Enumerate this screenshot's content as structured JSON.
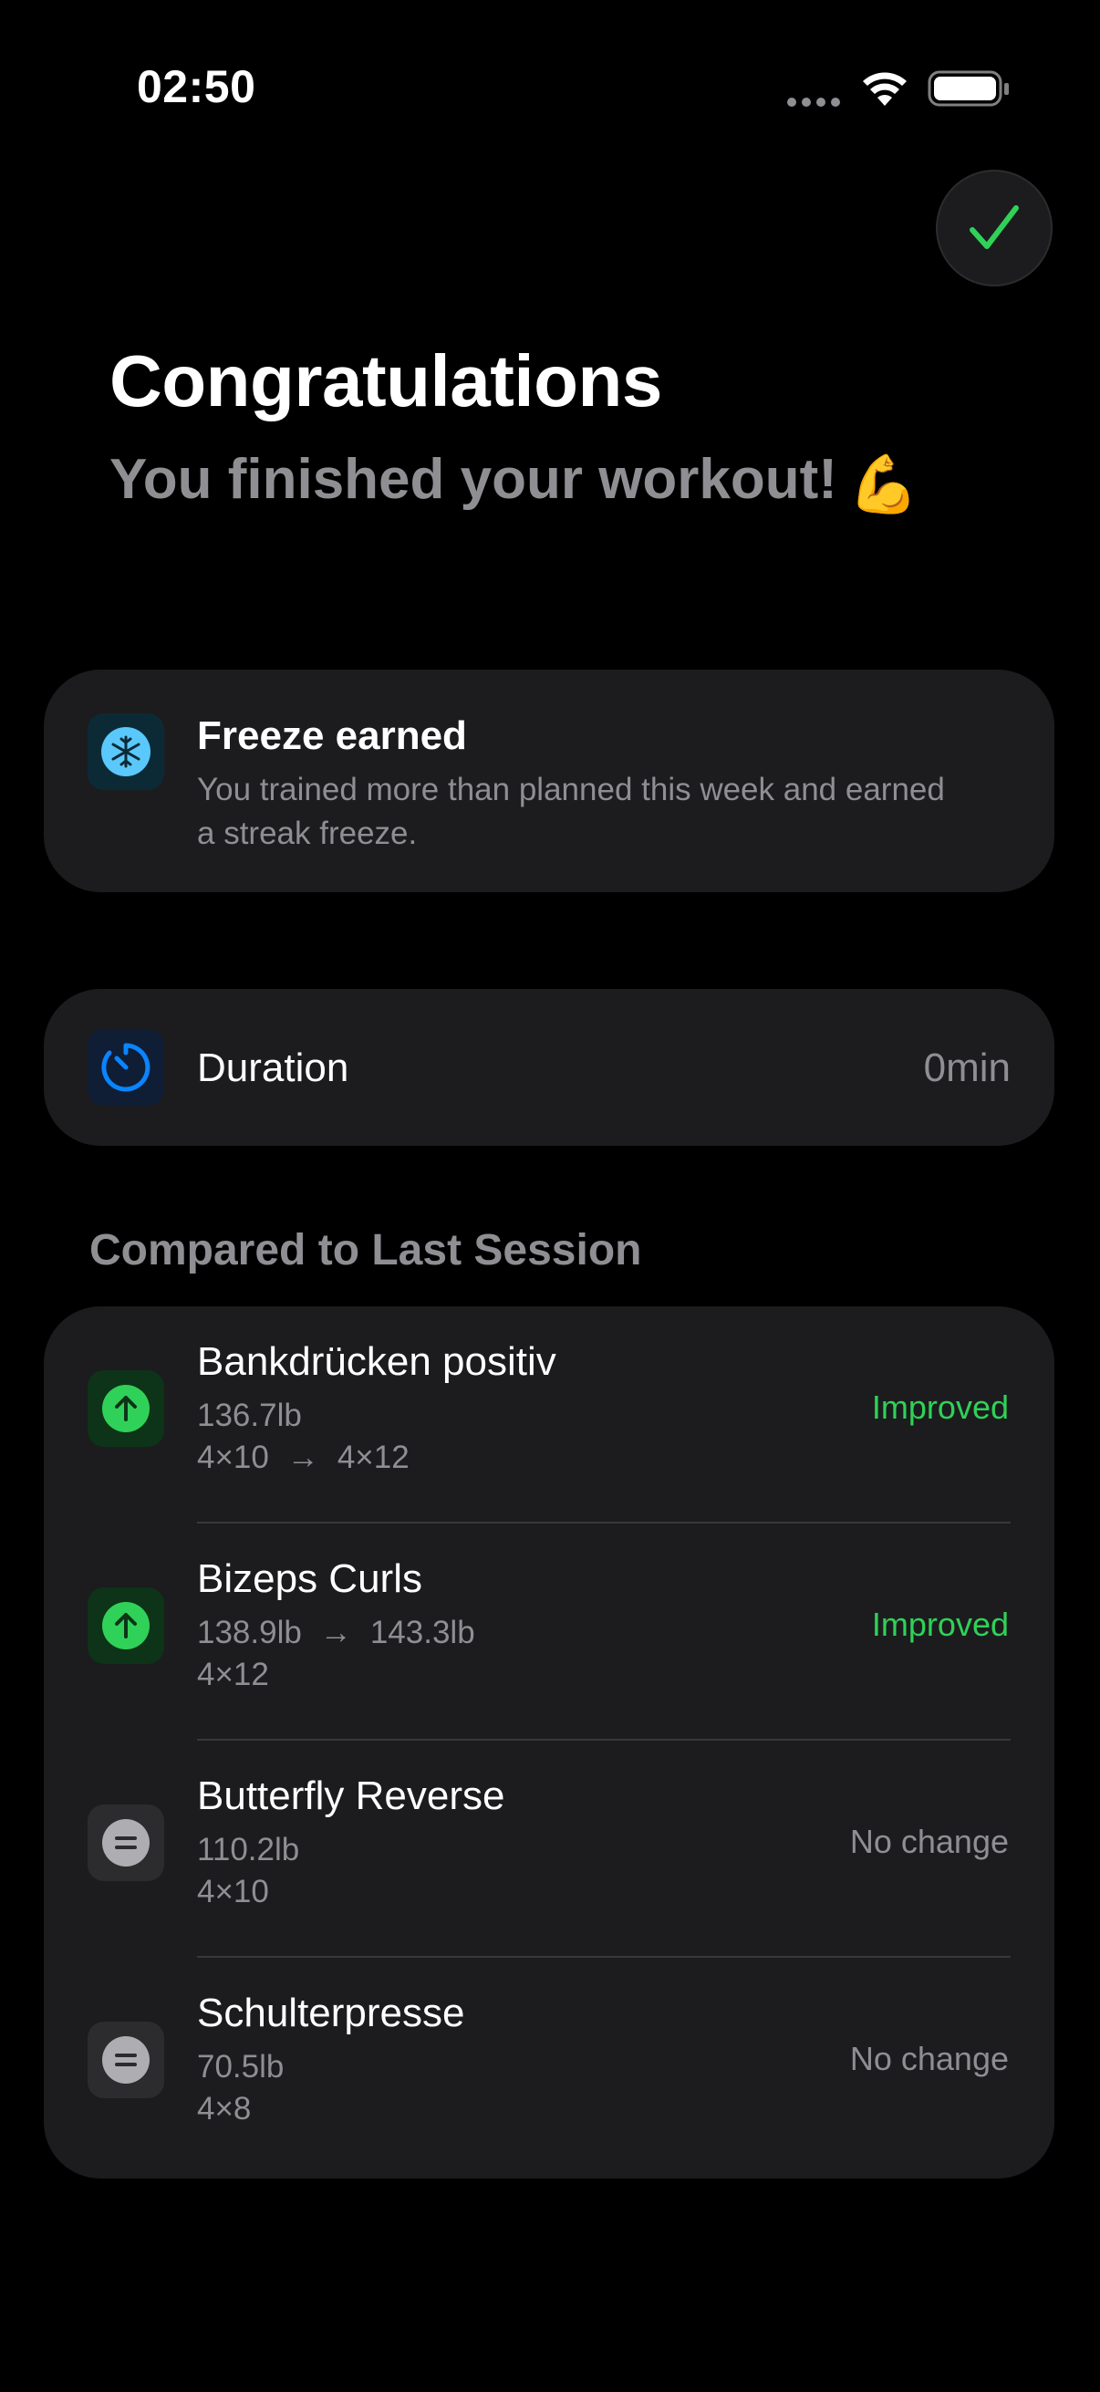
{
  "status_bar": {
    "time": "02:50"
  },
  "header": {
    "title": "Congratulations",
    "subtitle": "You finished your workout!",
    "subtitle_emoji": "💪"
  },
  "freeze_card": {
    "title": "Freeze earned",
    "description": "You trained more than planned this week and earned a streak freeze.",
    "icon": "snowflake-icon"
  },
  "duration": {
    "label": "Duration",
    "value": "0min",
    "icon": "timer-icon"
  },
  "comparison": {
    "section_title": "Compared to Last Session",
    "exercises": [
      {
        "name": "Bankdrücken positiv",
        "line1": "136.7lb",
        "line2_from": "4×10",
        "line2_to": "4×12",
        "status": "Improved",
        "icon": "arrow-up-icon"
      },
      {
        "name": "Bizeps Curls",
        "line1_from": "138.9lb",
        "line1_to": "143.3lb",
        "line2": "4×12",
        "status": "Improved",
        "icon": "arrow-up-icon"
      },
      {
        "name": "Butterfly Reverse",
        "line1": "110.2lb",
        "line2": "4×10",
        "status": "No change",
        "icon": "equal-icon"
      },
      {
        "name": "Schulterpresse",
        "line1": "70.5lb",
        "line2": "4×8",
        "status": "No change",
        "icon": "equal-icon"
      }
    ]
  },
  "colors": {
    "background": "#000000",
    "card": "#1c1c1e",
    "improved": "#30d158",
    "secondary_text": "#8e8e93",
    "done_check": "#30d158",
    "freeze_accent": "#5ac8fa",
    "duration_accent": "#0a84ff"
  }
}
